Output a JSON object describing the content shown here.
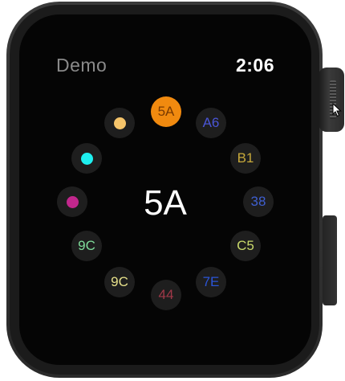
{
  "header": {
    "app_title": "Demo",
    "time": "2:06"
  },
  "center": {
    "selected_key": "5A"
  },
  "dial": {
    "items": [
      {
        "name": "dial-item-5a",
        "label": "5A",
        "color": "#7a3a00",
        "bg": "#f18a0f",
        "selected": true
      },
      {
        "name": "dial-item-a6",
        "label": "A6",
        "color": "#4a55d6"
      },
      {
        "name": "dial-item-b1",
        "label": "B1",
        "color": "#c7a93a"
      },
      {
        "name": "dial-item-38",
        "label": "38",
        "color": "#3f5fd0"
      },
      {
        "name": "dial-item-c5",
        "label": "C5",
        "color": "#c8d86a"
      },
      {
        "name": "dial-item-7e",
        "label": "7E",
        "color": "#2b55d8"
      },
      {
        "name": "dial-item-44",
        "label": "44",
        "color": "#a03848"
      },
      {
        "name": "dial-item-9c-yellow",
        "label": "9C",
        "color": "#e6e08a"
      },
      {
        "name": "dial-item-9c-green",
        "label": "9C",
        "color": "#7fdc9a"
      },
      {
        "name": "dial-item-magenta-dot",
        "label": "",
        "dot": "#c2278d"
      },
      {
        "name": "dial-item-cyan-dot",
        "label": "",
        "dot": "#1ef0f0"
      },
      {
        "name": "dial-item-orange-dot",
        "label": "",
        "dot": "#f5c46a"
      }
    ]
  }
}
